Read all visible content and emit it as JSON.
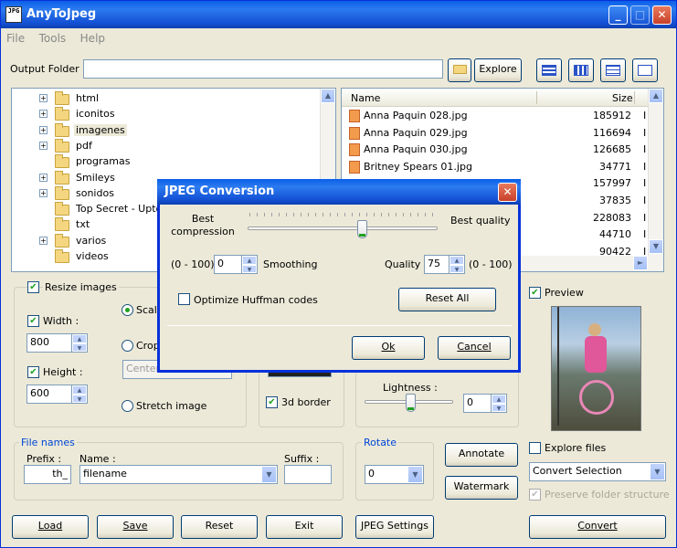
{
  "window": {
    "title": "AnyToJpeg",
    "app_icon_text": "JPG"
  },
  "menu": [
    "File",
    "Tools",
    "Help"
  ],
  "output": {
    "label": "Output Folder",
    "value": "",
    "explore_label": "Explore"
  },
  "tree": [
    {
      "label": "html",
      "expandable": true
    },
    {
      "label": "iconitos",
      "expandable": true
    },
    {
      "label": "imagenes",
      "expandable": true,
      "selected": true
    },
    {
      "label": "pdf",
      "expandable": true
    },
    {
      "label": "programas",
      "expandable": false
    },
    {
      "label": "Smileys",
      "expandable": true
    },
    {
      "label": "sonidos",
      "expandable": true
    },
    {
      "label": "Top Secret - Upto",
      "expandable": false
    },
    {
      "label": "txt",
      "expandable": false
    },
    {
      "label": "varios",
      "expandable": true
    },
    {
      "label": "videos",
      "expandable": false
    }
  ],
  "files": {
    "headers": {
      "name": "Name",
      "size": "Size",
      "extra": ""
    },
    "rows": [
      {
        "name": "Anna Paquin 028.jpg",
        "size": "185912",
        "extra": "I"
      },
      {
        "name": "Anna Paquin 029.jpg",
        "size": "116694",
        "extra": "I"
      },
      {
        "name": "Anna Paquin 030.jpg",
        "size": "126685",
        "extra": "I"
      },
      {
        "name": "Britney Spears 01.jpg",
        "size": "34771",
        "extra": "I"
      },
      {
        "name": "",
        "size": "157997",
        "extra": "I"
      },
      {
        "name": "",
        "size": "37835",
        "extra": "I"
      },
      {
        "name": "",
        "size": "228083",
        "extra": "I"
      },
      {
        "name": "",
        "size": "44710",
        "extra": "I"
      },
      {
        "name": "",
        "size": "90422",
        "extra": "I"
      }
    ]
  },
  "resize": {
    "title": "Resize images",
    "checked": true,
    "width_label": "Width :",
    "width_value": "800",
    "height_label": "Height :",
    "height_value": "600",
    "scale_label": "Scale",
    "crop_label": "Crop",
    "crop_option": "Center",
    "stretch_label": "Stretch image"
  },
  "border": {
    "label": "3d border",
    "checked": true
  },
  "lightness": {
    "label": "Lightness :",
    "value": "0"
  },
  "preview": {
    "label": "Preview",
    "checked": true
  },
  "file_names": {
    "title": "File names",
    "prefix_label": "Prefix :",
    "prefix_value": "th_",
    "name_label": "Name :",
    "name_value": "filename",
    "suffix_label": "Suffix :",
    "suffix_value": ""
  },
  "rotate": {
    "title": "Rotate",
    "value": "0"
  },
  "actions": {
    "annotate": "Annotate",
    "watermark": "Watermark"
  },
  "explore_files": {
    "label": "Explore files",
    "checked": false,
    "option": "Convert Selection",
    "preserve_label": "Preserve folder structure"
  },
  "bottom_buttons": {
    "load": "Load",
    "save": "Save",
    "reset": "Reset",
    "exit": "Exit",
    "jpeg_settings": "JPEG Settings",
    "convert": "Convert"
  },
  "dialog": {
    "title": "JPEG Conversion",
    "best_compression": "Best compression",
    "best_quality": "Best quality",
    "smoothing_range": "(0 - 100)",
    "smoothing_value": "0",
    "smoothing_label": "Smoothing",
    "quality_label": "Quality",
    "quality_value": "75",
    "quality_range": "(0 - 100)",
    "huffman_label": "Optimize Huffman codes",
    "huffman_checked": false,
    "reset_all": "Reset All",
    "ok": "Ok",
    "cancel": "Cancel",
    "quality_level": 0.6
  },
  "colors": {
    "title_blue": "#0a5fe8",
    "group_title": "#0046d5",
    "check": "#21a121"
  }
}
